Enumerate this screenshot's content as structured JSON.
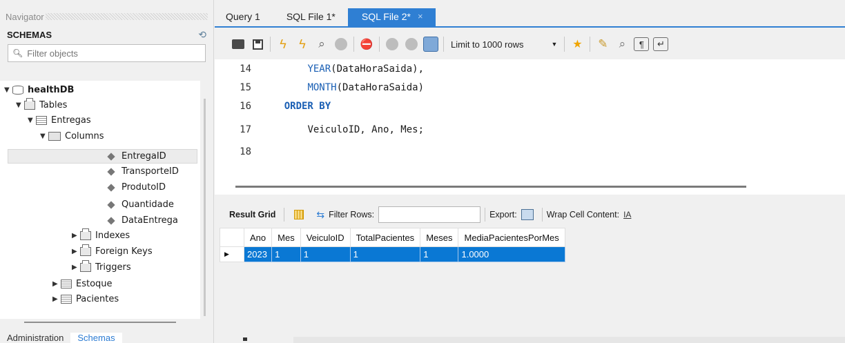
{
  "navigator": {
    "title": "Navigator",
    "schemas_label": "SCHEMAS",
    "filter_placeholder": "Filter objects",
    "tree": {
      "db": "healthDB",
      "tables": "Tables",
      "entregas": "Entregas",
      "columns": "Columns",
      "cols": [
        "EntregaID",
        "TransporteID",
        "ProdutoID",
        "Quantidade",
        "DataEntrega"
      ],
      "indexes": "Indexes",
      "foreign_keys": "Foreign Keys",
      "triggers": "Triggers",
      "estoque": "Estoque",
      "pacientes": "Pacientes"
    },
    "tabs": [
      "Administration",
      "Schemas"
    ]
  },
  "editor_tabs": [
    {
      "label": "Query 1"
    },
    {
      "label": "SQL File 1*"
    },
    {
      "label": "SQL File 2*",
      "close": "×"
    }
  ],
  "toolbar": {
    "limit_label": "Limit to 1000 rows"
  },
  "editor": {
    "lines": [
      {
        "num": "14",
        "indent": "        ",
        "parts": [
          {
            "t": "YEAR",
            "c": "fn"
          },
          {
            "t": "(DataHoraSaida),",
            "c": ""
          }
        ]
      },
      {
        "num": "15",
        "indent": "        ",
        "parts": [
          {
            "t": "MONTH",
            "c": "fn"
          },
          {
            "t": "(DataHoraSaida)",
            "c": ""
          }
        ]
      },
      {
        "num": "16",
        "indent": "    ",
        "parts": [
          {
            "t": "ORDER BY",
            "c": "kw"
          }
        ]
      },
      {
        "num": "17",
        "indent": "        ",
        "parts": [
          {
            "t": "VeiculoID, Ano, Mes;",
            "c": ""
          }
        ]
      },
      {
        "num": "18",
        "indent": "",
        "parts": []
      }
    ]
  },
  "result_bar": {
    "result_grid": "Result Grid",
    "filter_rows": "Filter Rows:",
    "export": "Export:",
    "wrap": "Wrap Cell Content:"
  },
  "grid": {
    "columns": [
      "Ano",
      "Mes",
      "VeiculoID",
      "TotalPacientes",
      "Meses",
      "MediaPacientesPorMes"
    ],
    "rows": [
      [
        "2023",
        "1",
        "1",
        "1",
        "1",
        "1.0000"
      ]
    ]
  }
}
